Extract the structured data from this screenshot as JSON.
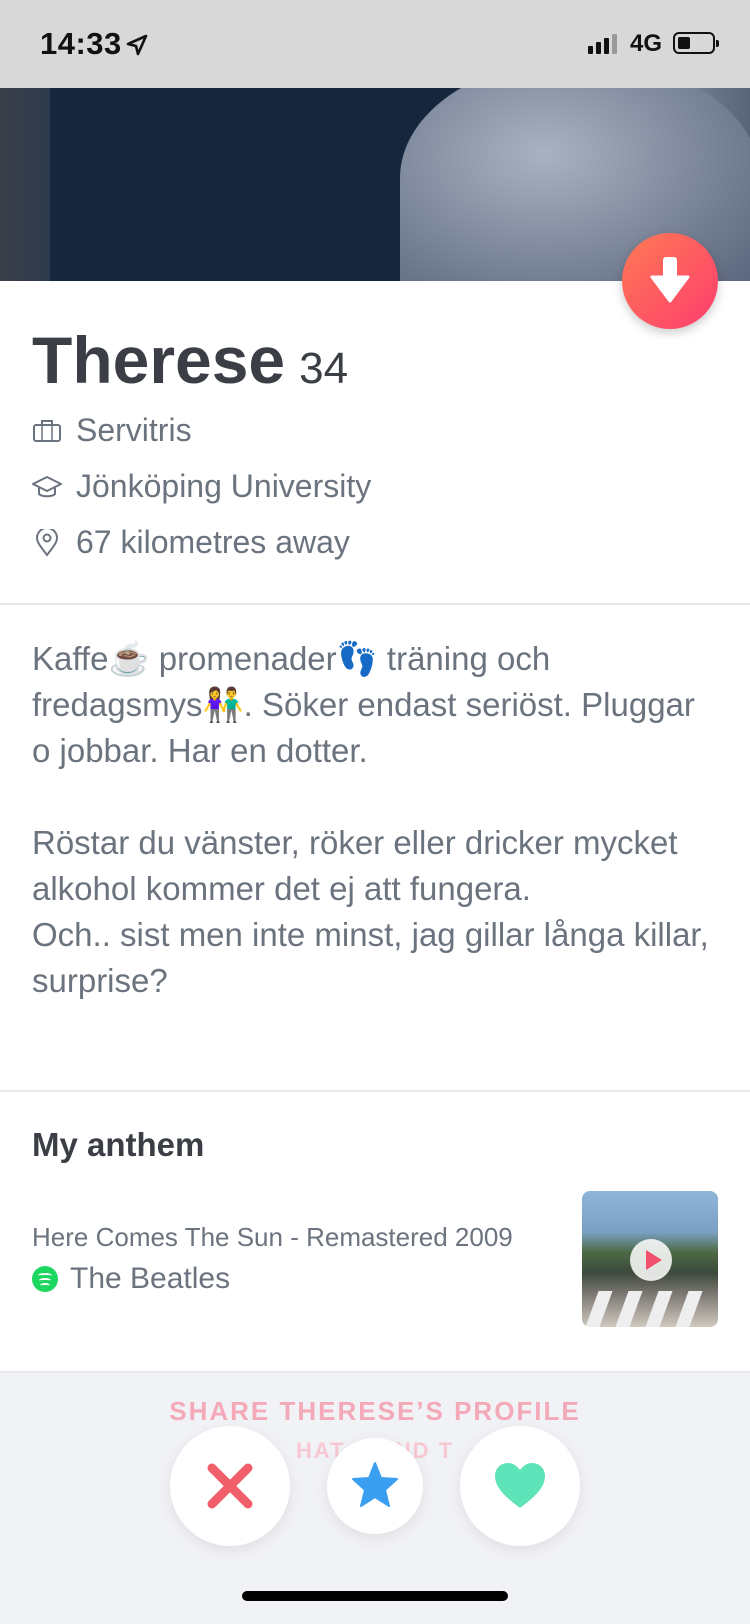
{
  "status_bar": {
    "time": "14:33",
    "network": "4G"
  },
  "profile": {
    "name": "Therese",
    "age": "34",
    "job": "Servitris",
    "school": "Jönköping University",
    "distance": "67 kilometres away"
  },
  "bio": "Kaffe☕️ promenader👣 träning och fredagsmys👫. Söker endast seriöst. Pluggar o jobbar. Har en dotter.\n\nRöstar du vänster, röker eller dricker mycket alkohol kommer det ej att fungera.\nOch.. sist men inte minst, jag gillar långa killar, surprise?",
  "anthem": {
    "title": "My anthem",
    "song": "Here Comes The Sun - Remastered 2009",
    "artist": "The Beatles"
  },
  "share": {
    "label": "SHARE THERESE’S PROFILE",
    "sublabel": "HAT A   END T"
  },
  "colors": {
    "accent_gradient": [
      "#ff7a54",
      "#fd3d6e"
    ],
    "nope": "#f1606a",
    "super_like": "#3a9ff0",
    "like": "#5fe3b8"
  },
  "icons": [
    "location-arrow-icon",
    "signal-icon",
    "battery-icon",
    "arrow-down-icon",
    "briefcase-icon",
    "graduation-cap-icon",
    "map-pin-icon",
    "spotify-icon",
    "play-icon",
    "nope-x-icon",
    "star-icon",
    "heart-icon"
  ]
}
